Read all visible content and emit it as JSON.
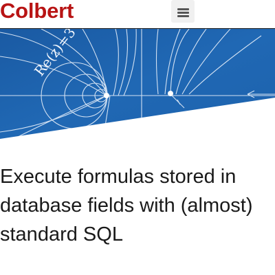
{
  "header": {
    "brand": "Colbert",
    "menu_icon": "hamburger-menu-icon"
  },
  "hero": {
    "formula_text": "Re(z)=3",
    "colors": {
      "background": "#1c5fa8",
      "line": "#e8f0fa"
    }
  },
  "main": {
    "headline": "Execute formulas stored in database fields with (almost) standard SQL"
  },
  "colors": {
    "brand": "#b81414",
    "text": "#1a1a1a"
  }
}
